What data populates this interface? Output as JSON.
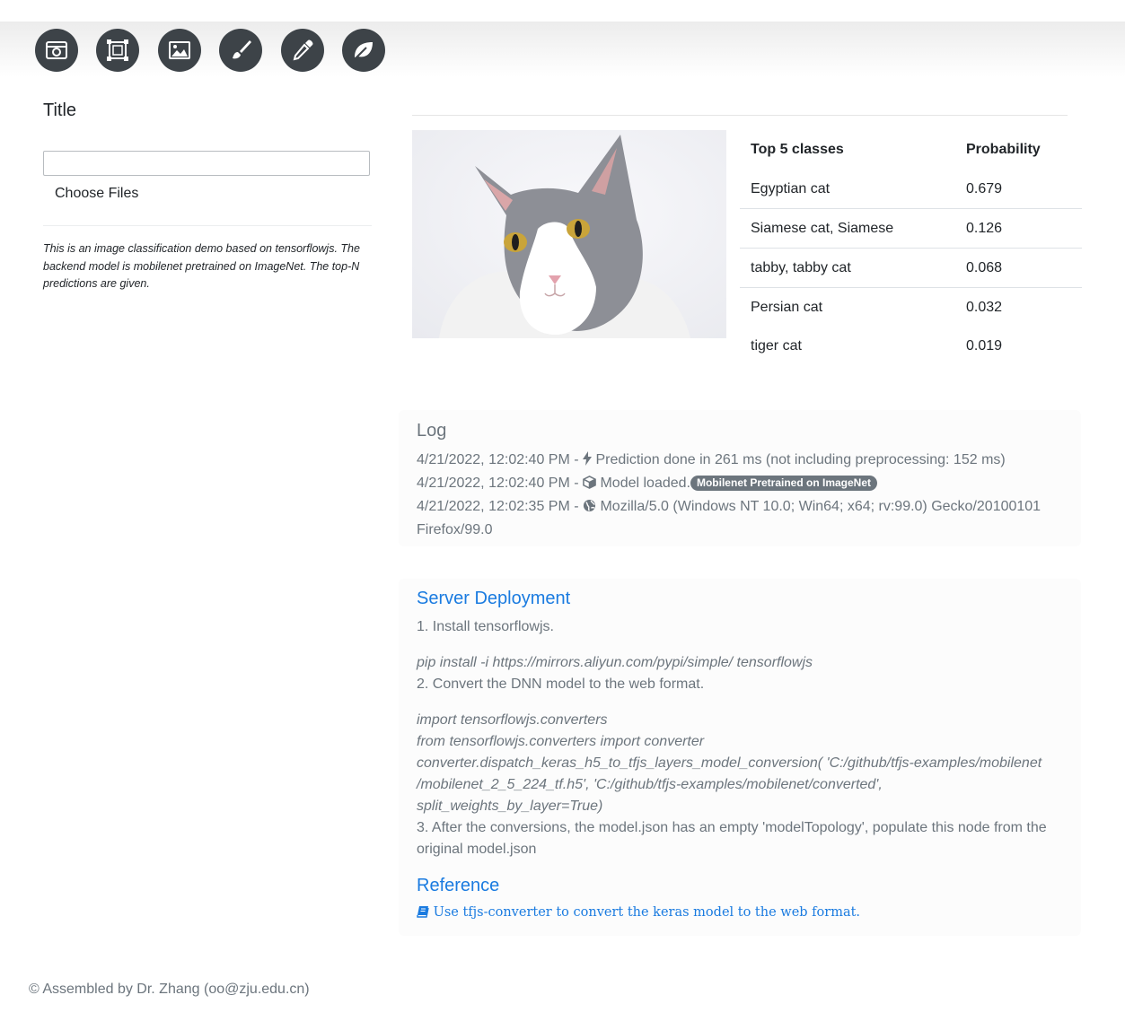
{
  "toolbar": {
    "tools": [
      {
        "icon": "camera-window-icon"
      },
      {
        "icon": "crop-frame-icon"
      },
      {
        "icon": "image-icon"
      },
      {
        "icon": "brush-icon"
      },
      {
        "icon": "eyedropper-icon"
      },
      {
        "icon": "leaf-icon"
      }
    ]
  },
  "sidebar": {
    "title": "Title",
    "input_value": "",
    "file_button": "Choose Files",
    "description": "This is an image classification demo based on tensorflowjs. The backend model is mobilenet pretrained on ImageNet. The top-N predictions are given."
  },
  "predictions": {
    "headers": [
      "Top 5 classes",
      "Probability"
    ],
    "rows": [
      {
        "label": "Egyptian cat",
        "prob": "0.679"
      },
      {
        "label": "Siamese cat, Siamese",
        "prob": "0.126"
      },
      {
        "label": "tabby, tabby cat",
        "prob": "0.068"
      },
      {
        "label": "Persian cat",
        "prob": "0.032"
      },
      {
        "label": "tiger cat",
        "prob": "0.019"
      }
    ]
  },
  "log": {
    "title": "Log",
    "entries": [
      {
        "time": "4/21/2022, 12:02:40 PM - ",
        "icon": "bolt-icon",
        "text": "Prediction done in 261 ms (not including preprocessing: 152 ms)"
      },
      {
        "time": "4/21/2022, 12:02:40 PM - ",
        "icon": "cube-icon",
        "text": "Model loaded.",
        "badge": "Mobilenet Pretrained on ImageNet"
      },
      {
        "time": "4/21/2022, 12:02:35 PM - ",
        "icon": "globe-icon",
        "text": "Mozilla/5.0 (Windows NT 10.0; Win64; x64; rv:99.0) Gecko/20100101 Firefox/99.0"
      }
    ]
  },
  "deployment": {
    "title": "Server Deployment",
    "step1": "1. Install tensorflowjs.",
    "cmd1": "pip install -i https://mirrors.aliyun.com/pypi/simple/ tensorflowjs",
    "step2": "2. Convert the DNN model to the web format.",
    "code1": "import tensorflowjs.converters",
    "code2": "from tensorflowjs.converters import converter",
    "code3": "converter.dispatch_keras_h5_to_tfjs_layers_model_conversion( 'C:/github/tfjs-examples/mobilenet /mobilenet_2_5_224_tf.h5', 'C:/github/tfjs-examples/mobilenet/converted', split_weights_by_layer=True)",
    "step3": "3. After the conversions, the model.json has an empty 'modelTopology', populate this node from the original model.json"
  },
  "reference": {
    "title": "Reference",
    "link": "Use tfjs-converter to convert the keras model to the web format."
  },
  "footer": "© Assembled by Dr. Zhang (oo@zju.edu.cn)"
}
